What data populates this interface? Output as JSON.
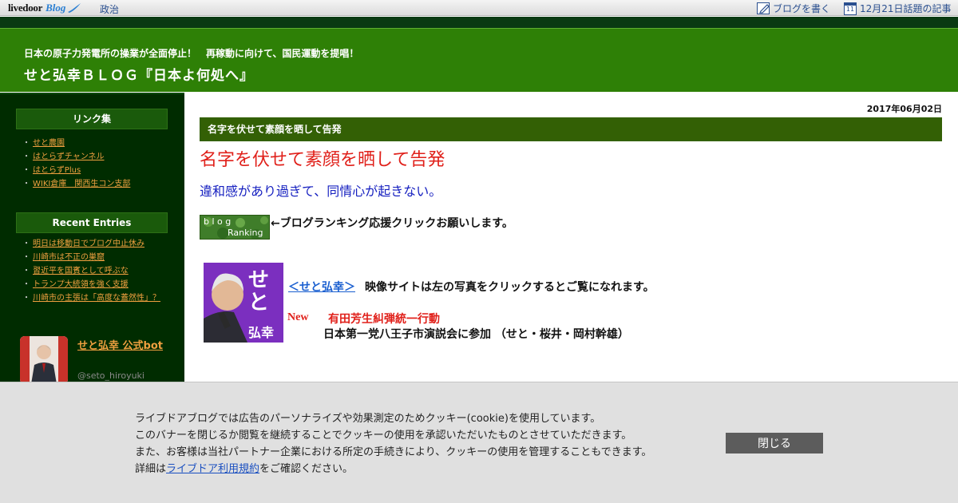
{
  "topbar": {
    "logo_livedoor": "livedoor",
    "logo_blog": "Blog",
    "category": "政治",
    "write_blog": "ブログを書く",
    "topics": "12月21日話題の記事",
    "calendar_day": "11"
  },
  "header": {
    "subtitle": "日本の原子力発電所の操業が全面停止！　再稼動に向けて、国民運動を提唱！",
    "title": "せと弘幸ＢＬＯＧ『日本よ何処へ』"
  },
  "sidebar": {
    "links_heading": "リンク集",
    "links": [
      "せと農園",
      "はとらずチャンネル",
      "はとらずPlus",
      "WIKI倉庫　関西生コン支部"
    ],
    "recent_heading": "Recent Entries",
    "recent": [
      "明日は移動日でブログ中止休み",
      "川崎市は不正の巣窟",
      "習近平を国賓として呼ぶな",
      "トランプ大統領を強く支援",
      "川崎市の主張は「高度な蓋然性」？"
    ],
    "bot_name": "せと弘幸 公式bot",
    "bot_handle": "@seto_hiroyuki"
  },
  "entry": {
    "date": "2017年06月02日",
    "bar_title": "名字を伏せて素顔を晒して告発",
    "heading": "名字を伏せて素顔を晒して告発",
    "subheading": "違和感があり過ぎて、同情心が起きない。",
    "rank_label_top": "b l o g",
    "rank_label_bottom": "Ranking",
    "rank_text": "←ブログランキング応援クリックお願いします。",
    "photo_name_top": "せと",
    "photo_name_bottom": "弘幸",
    "seto_link": "＜せと弘幸＞",
    "seto_rest": "映像サイトは左の写真をクリックするとご覧になれます。",
    "new_label": "New",
    "new_event": "有田芳生糾弾統一行動",
    "new_detail": "日本第一党八王子市演説会に参加 （せと・桜井・岡村幹雄）"
  },
  "cookie": {
    "line1": "ライブドアブログでは広告のパーソナライズや効果測定のためクッキー(cookie)を使用しています。",
    "line2": "このバナーを閉じるか閲覧を継続することでクッキーの使用を承認いただいたものとさせていただきます。",
    "line3": "また、お客様は当社パートナー企業における所定の手続きにより、クッキーの使用を管理することもできます。",
    "line4_prefix": "詳細は",
    "line4_link": "ライブドア利用規約",
    "line4_suffix": "をご確認ください。",
    "close_label": "閉じる"
  },
  "colors": {
    "header_green": "#2e8006",
    "sidebar_dark": "#002c00",
    "entry_bar": "#336005",
    "accent_red": "#e0201a",
    "link_orange": "#f0a040"
  }
}
